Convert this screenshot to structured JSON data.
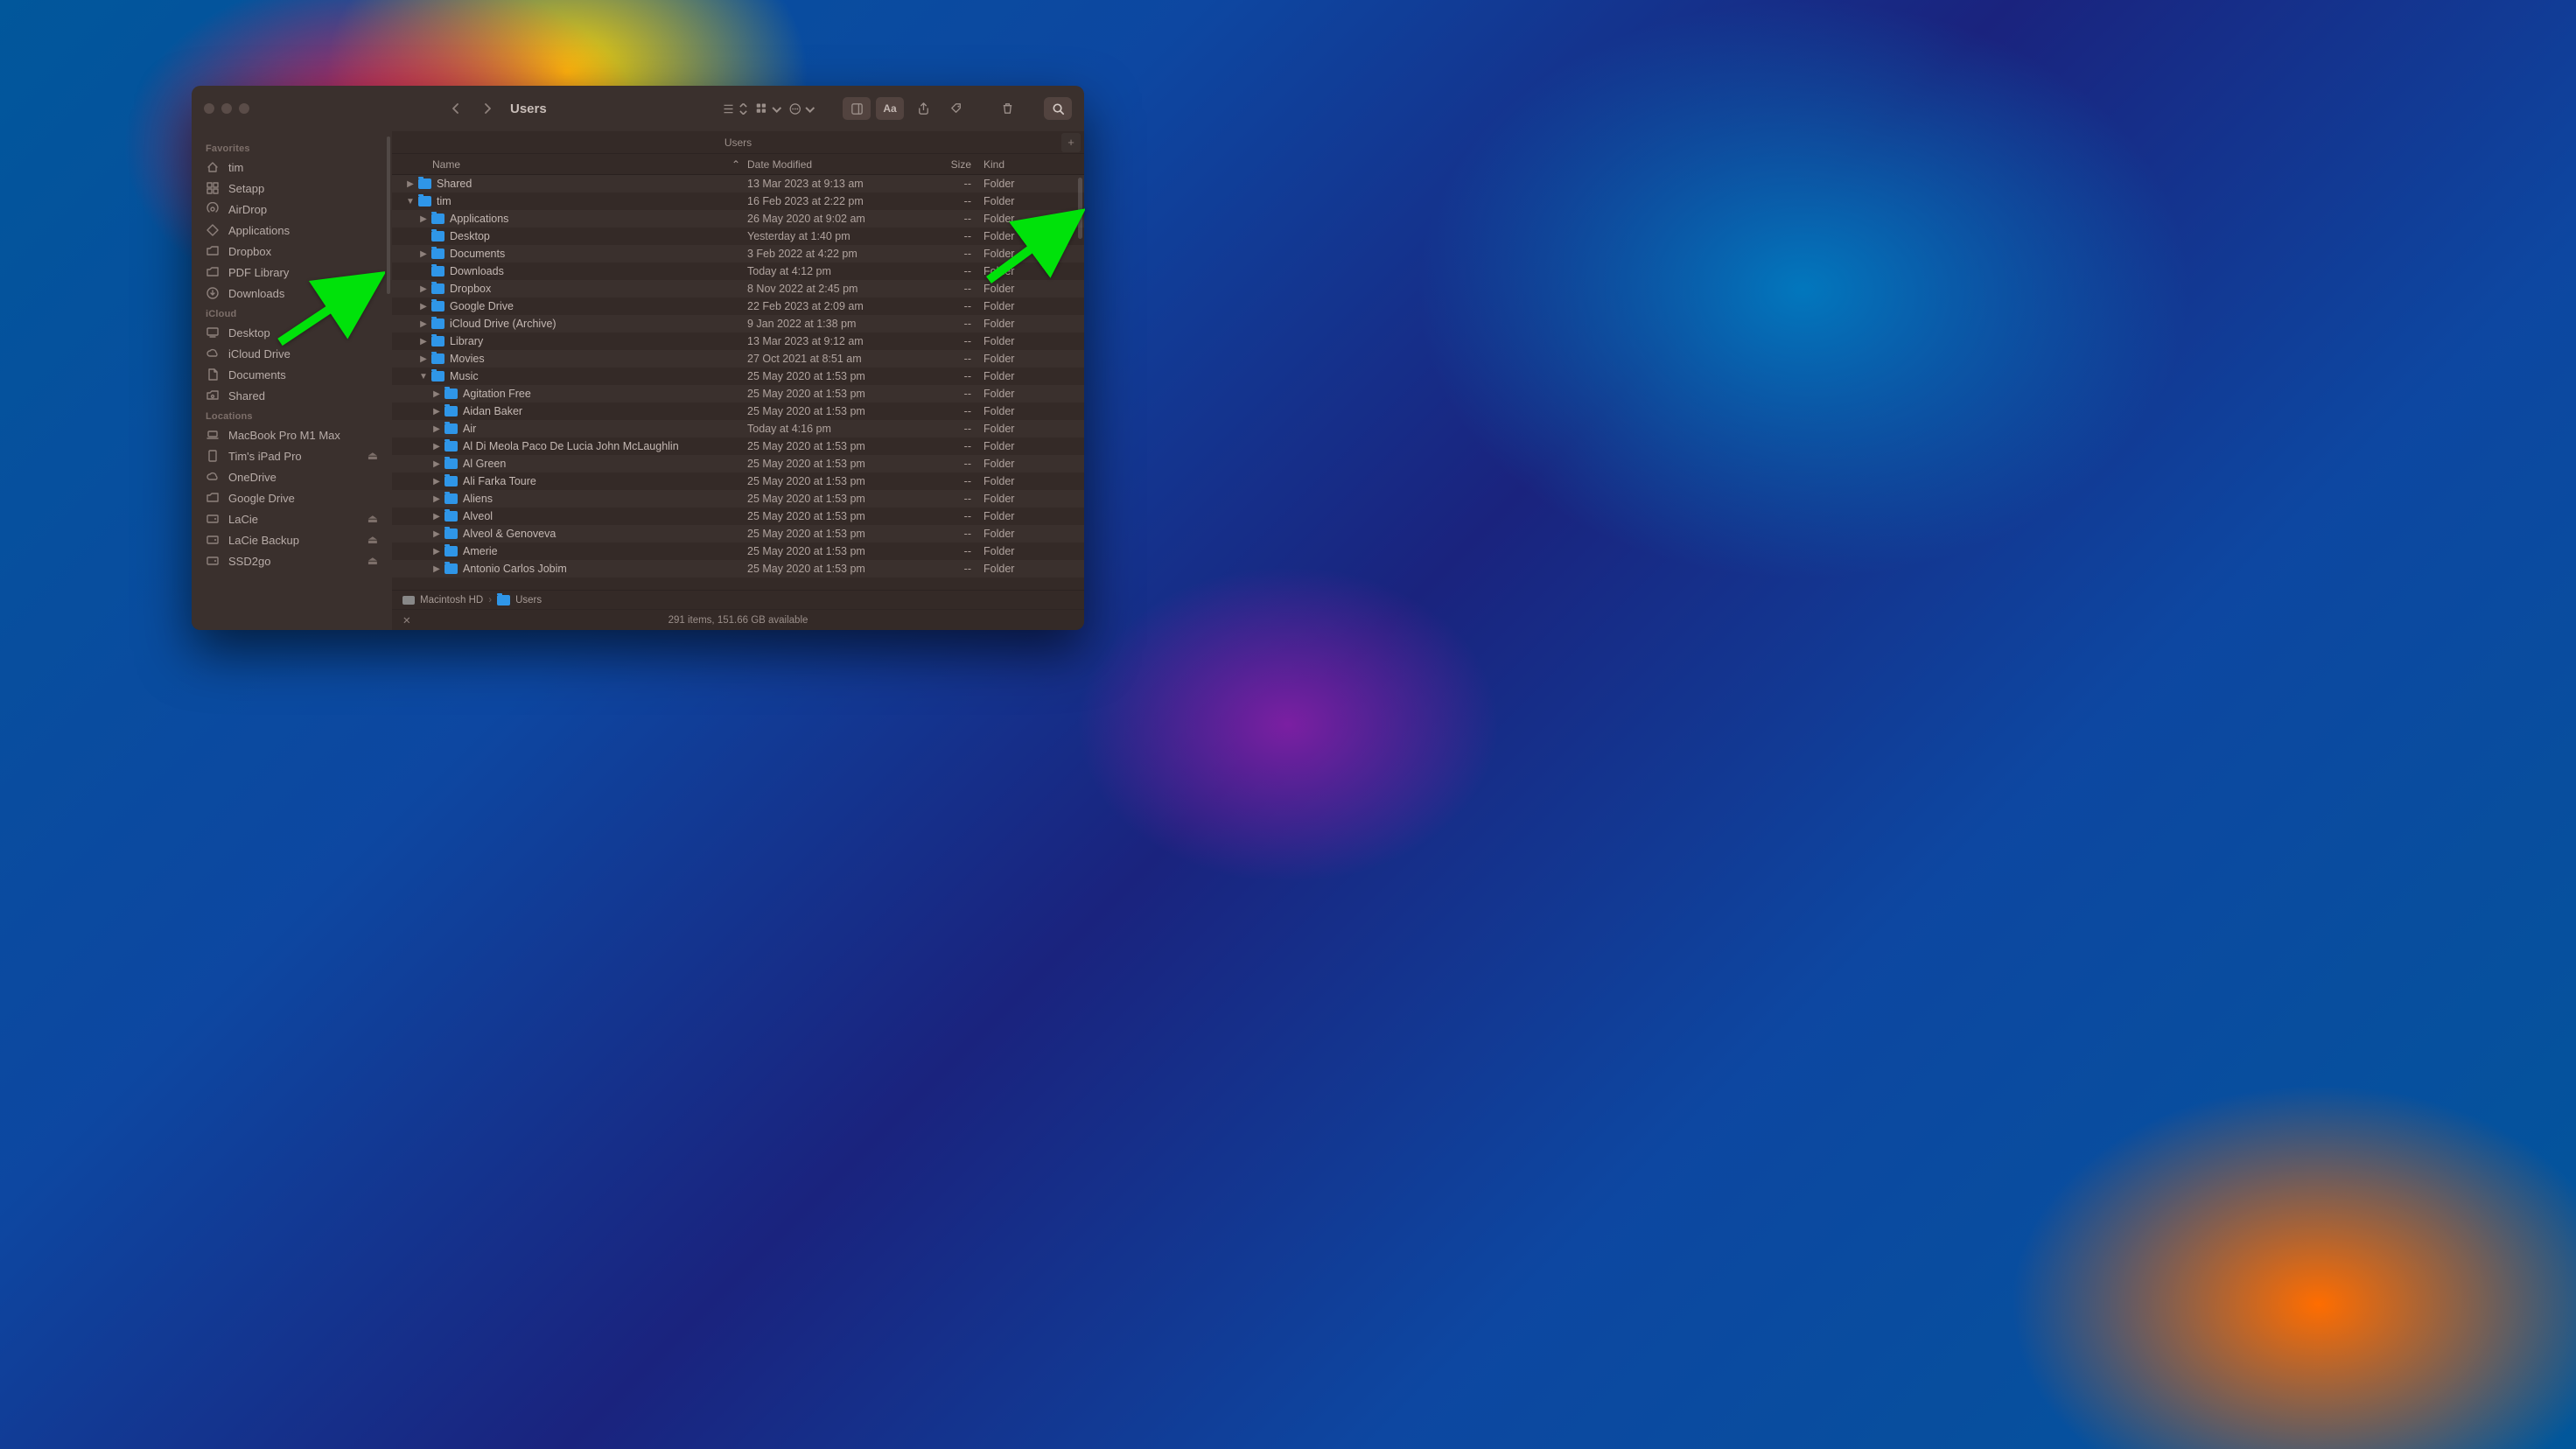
{
  "window": {
    "title": "Users",
    "tab": "Users"
  },
  "sidebar": {
    "sections": [
      {
        "title": "Favorites",
        "items": [
          {
            "icon": "home",
            "label": "tim"
          },
          {
            "icon": "grid",
            "label": "Setapp"
          },
          {
            "icon": "airdrop",
            "label": "AirDrop"
          },
          {
            "icon": "apps",
            "label": "Applications"
          },
          {
            "icon": "folder",
            "label": "Dropbox"
          },
          {
            "icon": "folder",
            "label": "PDF Library"
          },
          {
            "icon": "download",
            "label": "Downloads"
          }
        ]
      },
      {
        "title": "iCloud",
        "items": [
          {
            "icon": "desktop",
            "label": "Desktop"
          },
          {
            "icon": "cloud",
            "label": "iCloud Drive"
          },
          {
            "icon": "doc",
            "label": "Documents"
          },
          {
            "icon": "shared",
            "label": "Shared"
          }
        ]
      },
      {
        "title": "Locations",
        "items": [
          {
            "icon": "laptop",
            "label": "MacBook Pro M1 Max"
          },
          {
            "icon": "ipad",
            "label": "Tim's iPad Pro",
            "eject": true
          },
          {
            "icon": "cloud",
            "label": "OneDrive"
          },
          {
            "icon": "folder",
            "label": "Google Drive"
          },
          {
            "icon": "disk",
            "label": "LaCie",
            "eject": true
          },
          {
            "icon": "disk",
            "label": "LaCie Backup",
            "eject": true
          },
          {
            "icon": "disk",
            "label": "SSD2go",
            "eject": true
          }
        ]
      }
    ]
  },
  "columns": {
    "name": "Name",
    "date": "Date Modified",
    "size": "Size",
    "kind": "Kind"
  },
  "rows": [
    {
      "indent": 0,
      "disc": "right",
      "name": "Shared",
      "date": "13 Mar 2023 at 9:13 am",
      "size": "--",
      "kind": "Folder"
    },
    {
      "indent": 0,
      "disc": "down",
      "name": "tim",
      "date": "16 Feb 2023 at 2:22 pm",
      "size": "--",
      "kind": "Folder"
    },
    {
      "indent": 1,
      "disc": "right",
      "name": "Applications",
      "date": "26 May 2020 at 9:02 am",
      "size": "--",
      "kind": "Folder"
    },
    {
      "indent": 1,
      "disc": "none",
      "name": "Desktop",
      "date": "Yesterday at 1:40 pm",
      "size": "--",
      "kind": "Folder"
    },
    {
      "indent": 1,
      "disc": "right",
      "name": "Documents",
      "date": "3 Feb 2022 at 4:22 pm",
      "size": "--",
      "kind": "Folder"
    },
    {
      "indent": 1,
      "disc": "none",
      "name": "Downloads",
      "date": "Today at 4:12 pm",
      "size": "--",
      "kind": "Folder"
    },
    {
      "indent": 1,
      "disc": "right",
      "name": "Dropbox",
      "date": "8 Nov 2022 at 2:45 pm",
      "size": "--",
      "kind": "Folder"
    },
    {
      "indent": 1,
      "disc": "right",
      "name": "Google Drive",
      "date": "22 Feb 2023 at 2:09 am",
      "size": "--",
      "kind": "Folder"
    },
    {
      "indent": 1,
      "disc": "right",
      "name": "iCloud Drive (Archive)",
      "date": "9 Jan 2022 at 1:38 pm",
      "size": "--",
      "kind": "Folder"
    },
    {
      "indent": 1,
      "disc": "right",
      "name": "Library",
      "date": "13 Mar 2023 at 9:12 am",
      "size": "--",
      "kind": "Folder"
    },
    {
      "indent": 1,
      "disc": "right",
      "name": "Movies",
      "date": "27 Oct 2021 at 8:51 am",
      "size": "--",
      "kind": "Folder"
    },
    {
      "indent": 1,
      "disc": "down",
      "name": "Music",
      "date": "25 May 2020 at 1:53 pm",
      "size": "--",
      "kind": "Folder"
    },
    {
      "indent": 2,
      "disc": "right",
      "name": "Agitation Free",
      "date": "25 May 2020 at 1:53 pm",
      "size": "--",
      "kind": "Folder"
    },
    {
      "indent": 2,
      "disc": "right",
      "name": "Aidan Baker",
      "date": "25 May 2020 at 1:53 pm",
      "size": "--",
      "kind": "Folder"
    },
    {
      "indent": 2,
      "disc": "right",
      "name": "Air",
      "date": "Today at 4:16 pm",
      "size": "--",
      "kind": "Folder"
    },
    {
      "indent": 2,
      "disc": "right",
      "name": "Al Di Meola Paco De Lucia John McLaughlin",
      "date": "25 May 2020 at 1:53 pm",
      "size": "--",
      "kind": "Folder"
    },
    {
      "indent": 2,
      "disc": "right",
      "name": "Al Green",
      "date": "25 May 2020 at 1:53 pm",
      "size": "--",
      "kind": "Folder"
    },
    {
      "indent": 2,
      "disc": "right",
      "name": "Ali Farka Toure",
      "date": "25 May 2020 at 1:53 pm",
      "size": "--",
      "kind": "Folder"
    },
    {
      "indent": 2,
      "disc": "right",
      "name": "Aliens",
      "date": "25 May 2020 at 1:53 pm",
      "size": "--",
      "kind": "Folder"
    },
    {
      "indent": 2,
      "disc": "right",
      "name": "Alveol",
      "date": "25 May 2020 at 1:53 pm",
      "size": "--",
      "kind": "Folder"
    },
    {
      "indent": 2,
      "disc": "right",
      "name": "Alveol & Genoveva",
      "date": "25 May 2020 at 1:53 pm",
      "size": "--",
      "kind": "Folder"
    },
    {
      "indent": 2,
      "disc": "right",
      "name": "Amerie",
      "date": "25 May 2020 at 1:53 pm",
      "size": "--",
      "kind": "Folder"
    },
    {
      "indent": 2,
      "disc": "right",
      "name": "Antonio Carlos Jobim",
      "date": "25 May 2020 at 1:53 pm",
      "size": "--",
      "kind": "Folder"
    }
  ],
  "path": {
    "root": "Macintosh HD",
    "folder": "Users"
  },
  "status": "291 items, 151.66 GB available"
}
